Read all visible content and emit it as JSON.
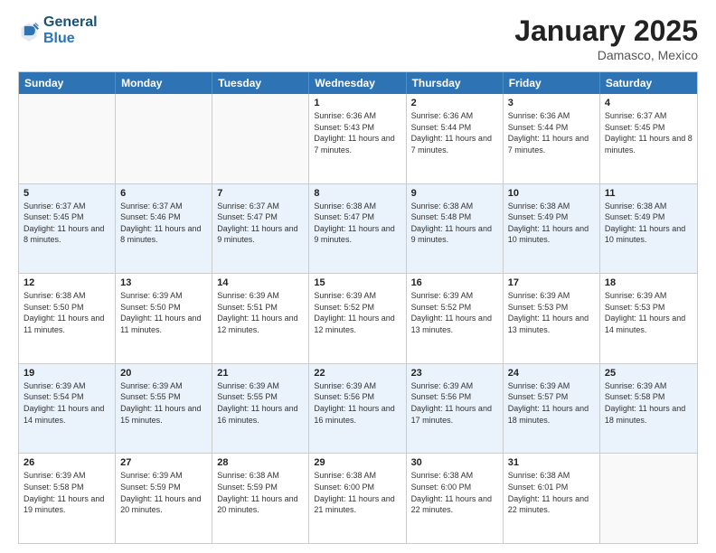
{
  "logo": {
    "line1": "General",
    "line2": "Blue"
  },
  "title": "January 2025",
  "location": "Damasco, Mexico",
  "header_days": [
    "Sunday",
    "Monday",
    "Tuesday",
    "Wednesday",
    "Thursday",
    "Friday",
    "Saturday"
  ],
  "rows": [
    [
      {
        "day": "",
        "info": "",
        "empty": true
      },
      {
        "day": "",
        "info": "",
        "empty": true
      },
      {
        "day": "",
        "info": "",
        "empty": true
      },
      {
        "day": "1",
        "info": "Sunrise: 6:36 AM\nSunset: 5:43 PM\nDaylight: 11 hours and 7 minutes.",
        "empty": false
      },
      {
        "day": "2",
        "info": "Sunrise: 6:36 AM\nSunset: 5:44 PM\nDaylight: 11 hours and 7 minutes.",
        "empty": false
      },
      {
        "day": "3",
        "info": "Sunrise: 6:36 AM\nSunset: 5:44 PM\nDaylight: 11 hours and 7 minutes.",
        "empty": false
      },
      {
        "day": "4",
        "info": "Sunrise: 6:37 AM\nSunset: 5:45 PM\nDaylight: 11 hours and 8 minutes.",
        "empty": false
      }
    ],
    [
      {
        "day": "5",
        "info": "Sunrise: 6:37 AM\nSunset: 5:45 PM\nDaylight: 11 hours and 8 minutes.",
        "empty": false
      },
      {
        "day": "6",
        "info": "Sunrise: 6:37 AM\nSunset: 5:46 PM\nDaylight: 11 hours and 8 minutes.",
        "empty": false
      },
      {
        "day": "7",
        "info": "Sunrise: 6:37 AM\nSunset: 5:47 PM\nDaylight: 11 hours and 9 minutes.",
        "empty": false
      },
      {
        "day": "8",
        "info": "Sunrise: 6:38 AM\nSunset: 5:47 PM\nDaylight: 11 hours and 9 minutes.",
        "empty": false
      },
      {
        "day": "9",
        "info": "Sunrise: 6:38 AM\nSunset: 5:48 PM\nDaylight: 11 hours and 9 minutes.",
        "empty": false
      },
      {
        "day": "10",
        "info": "Sunrise: 6:38 AM\nSunset: 5:49 PM\nDaylight: 11 hours and 10 minutes.",
        "empty": false
      },
      {
        "day": "11",
        "info": "Sunrise: 6:38 AM\nSunset: 5:49 PM\nDaylight: 11 hours and 10 minutes.",
        "empty": false
      }
    ],
    [
      {
        "day": "12",
        "info": "Sunrise: 6:38 AM\nSunset: 5:50 PM\nDaylight: 11 hours and 11 minutes.",
        "empty": false
      },
      {
        "day": "13",
        "info": "Sunrise: 6:39 AM\nSunset: 5:50 PM\nDaylight: 11 hours and 11 minutes.",
        "empty": false
      },
      {
        "day": "14",
        "info": "Sunrise: 6:39 AM\nSunset: 5:51 PM\nDaylight: 11 hours and 12 minutes.",
        "empty": false
      },
      {
        "day": "15",
        "info": "Sunrise: 6:39 AM\nSunset: 5:52 PM\nDaylight: 11 hours and 12 minutes.",
        "empty": false
      },
      {
        "day": "16",
        "info": "Sunrise: 6:39 AM\nSunset: 5:52 PM\nDaylight: 11 hours and 13 minutes.",
        "empty": false
      },
      {
        "day": "17",
        "info": "Sunrise: 6:39 AM\nSunset: 5:53 PM\nDaylight: 11 hours and 13 minutes.",
        "empty": false
      },
      {
        "day": "18",
        "info": "Sunrise: 6:39 AM\nSunset: 5:53 PM\nDaylight: 11 hours and 14 minutes.",
        "empty": false
      }
    ],
    [
      {
        "day": "19",
        "info": "Sunrise: 6:39 AM\nSunset: 5:54 PM\nDaylight: 11 hours and 14 minutes.",
        "empty": false
      },
      {
        "day": "20",
        "info": "Sunrise: 6:39 AM\nSunset: 5:55 PM\nDaylight: 11 hours and 15 minutes.",
        "empty": false
      },
      {
        "day": "21",
        "info": "Sunrise: 6:39 AM\nSunset: 5:55 PM\nDaylight: 11 hours and 16 minutes.",
        "empty": false
      },
      {
        "day": "22",
        "info": "Sunrise: 6:39 AM\nSunset: 5:56 PM\nDaylight: 11 hours and 16 minutes.",
        "empty": false
      },
      {
        "day": "23",
        "info": "Sunrise: 6:39 AM\nSunset: 5:56 PM\nDaylight: 11 hours and 17 minutes.",
        "empty": false
      },
      {
        "day": "24",
        "info": "Sunrise: 6:39 AM\nSunset: 5:57 PM\nDaylight: 11 hours and 18 minutes.",
        "empty": false
      },
      {
        "day": "25",
        "info": "Sunrise: 6:39 AM\nSunset: 5:58 PM\nDaylight: 11 hours and 18 minutes.",
        "empty": false
      }
    ],
    [
      {
        "day": "26",
        "info": "Sunrise: 6:39 AM\nSunset: 5:58 PM\nDaylight: 11 hours and 19 minutes.",
        "empty": false
      },
      {
        "day": "27",
        "info": "Sunrise: 6:39 AM\nSunset: 5:59 PM\nDaylight: 11 hours and 20 minutes.",
        "empty": false
      },
      {
        "day": "28",
        "info": "Sunrise: 6:38 AM\nSunset: 5:59 PM\nDaylight: 11 hours and 20 minutes.",
        "empty": false
      },
      {
        "day": "29",
        "info": "Sunrise: 6:38 AM\nSunset: 6:00 PM\nDaylight: 11 hours and 21 minutes.",
        "empty": false
      },
      {
        "day": "30",
        "info": "Sunrise: 6:38 AM\nSunset: 6:00 PM\nDaylight: 11 hours and 22 minutes.",
        "empty": false
      },
      {
        "day": "31",
        "info": "Sunrise: 6:38 AM\nSunset: 6:01 PM\nDaylight: 11 hours and 22 minutes.",
        "empty": false
      },
      {
        "day": "",
        "info": "",
        "empty": true
      }
    ]
  ]
}
